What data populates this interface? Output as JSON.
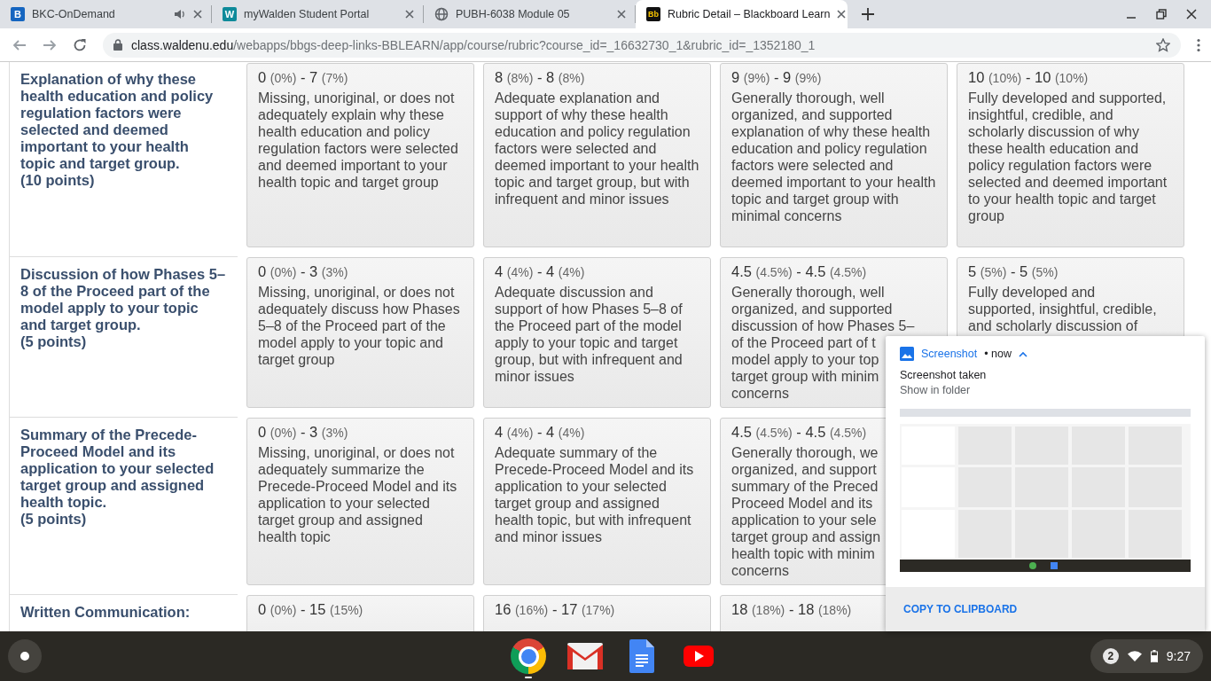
{
  "browser": {
    "tabs": [
      {
        "title": "BKC-OnDemand",
        "selected": false,
        "playing_audio": true,
        "favicon": {
          "kind": "letter",
          "glyph": "B",
          "color": "#1565c0"
        }
      },
      {
        "title": "myWalden Student Portal",
        "selected": false,
        "playing_audio": false,
        "favicon": {
          "kind": "letter",
          "glyph": "W",
          "color": "#0e8a9a"
        }
      },
      {
        "title": "PUBH-6038 Module 05",
        "selected": false,
        "playing_audio": false,
        "favicon": {
          "kind": "globe"
        }
      },
      {
        "title": "Rubric Detail – Blackboard Learn",
        "selected": true,
        "playing_audio": false,
        "favicon": {
          "kind": "letter",
          "glyph": "Bb",
          "color": "#111111"
        }
      }
    ],
    "address": {
      "host": "class.waldenu.edu",
      "path": "/webapps/bbgs-deep-links-BBLEARN/app/course/rubric?course_id=_16632730_1&rubric_id=_1352180_1"
    }
  },
  "rubric": {
    "rows": [
      {
        "criterion": "Explanation of why these health education and policy regulation factors were selected and deemed important to your health topic and target group.",
        "points": "(10 points)",
        "cells": [
          {
            "range": [
              "0 ",
              "(0%)",
              " - 7 ",
              "(7%)"
            ],
            "description": "Missing, unoriginal, or does not adequately explain why these health education and policy regulation factors were selected and deemed important to your health topic and target group"
          },
          {
            "range": [
              "8 ",
              "(8%)",
              " - 8 ",
              "(8%)"
            ],
            "description": "Adequate explanation and support of why these health education and policy regulation factors were selected and deemed important to your health topic and target group, but with infrequent and minor issues"
          },
          {
            "range": [
              "9 ",
              "(9%)",
              " - 9 ",
              "(9%)"
            ],
            "description": "Generally thorough, well organized, and supported explanation of why these health education and policy regulation factors were selected and deemed important to your health topic and target group with minimal concerns"
          },
          {
            "range": [
              "10 ",
              "(10%)",
              " - 10 ",
              "(10%)"
            ],
            "description": "Fully developed and supported, insightful, credible, and scholarly discussion of why these health education and policy regulation factors were selected and deemed important to your health topic and target group"
          }
        ]
      },
      {
        "criterion": "Discussion of how Phases 5–8 of the Proceed part of the model apply to your topic and target group.",
        "points": "(5 points)",
        "cells": [
          {
            "range": [
              "0 ",
              "(0%)",
              " - 3 ",
              "(3%)"
            ],
            "description": "Missing, unoriginal, or does not adequately discuss how Phases 5–8 of the Proceed part of the model apply to your topic and target group"
          },
          {
            "range": [
              "4 ",
              "(4%)",
              " - 4 ",
              "(4%)"
            ],
            "description": "Adequate discussion and support of how Phases 5–8 of the Proceed part of the model apply to your topic and target group, but with infrequent and minor issues"
          },
          {
            "range": [
              "4.5 ",
              "(4.5%)",
              " - 4.5 ",
              "(4.5%)"
            ],
            "description": "Generally thorough, well\norganized, and supported\ndiscussion of how Phases 5–\nof the Proceed part of t\nmodel apply to your top\ntarget group with minim\nconcerns"
          },
          {
            "range": [
              "5 ",
              "(5%)",
              " - 5 ",
              "(5%)"
            ],
            "description": "Fully developed and\nsupported, insightful, credible,\nand scholarly discussion of"
          }
        ]
      },
      {
        "criterion": "Summary of the Precede-Proceed Model and its application to your selected target group and assigned health topic.",
        "points": "(5 points)",
        "cells": [
          {
            "range": [
              "0 ",
              "(0%)",
              " - 3 ",
              "(3%)"
            ],
            "description": "Missing, unoriginal, or does not adequately summarize the Precede-Proceed Model and its application to your selected target group and assigned health topic"
          },
          {
            "range": [
              "4 ",
              "(4%)",
              " - 4 ",
              "(4%)"
            ],
            "description": "Adequate summary of the Precede-Proceed Model and its application to your selected target group and assigned health topic, but with infrequent and minor issues"
          },
          {
            "range": [
              "4.5 ",
              "(4.5%)",
              " - 4.5 ",
              "(4.5%)"
            ],
            "description": "Generally thorough, we\norganized, and support\nsummary of the Preced\nProceed Model and its\napplication to your sele\ntarget group and assign\nhealth topic with minim\nconcerns"
          },
          {}
        ]
      },
      {
        "criterion": "Written Communication:",
        "cells": [
          {
            "range": [
              "0 ",
              "(0%)",
              " - 15 ",
              "(15%)"
            ]
          },
          {
            "range": [
              "16 ",
              "(16%)",
              " - 17 ",
              "(17%)"
            ]
          },
          {
            "range": [
              "18 ",
              "(18%)",
              " - 18 ",
              "(18%)"
            ]
          },
          {}
        ]
      }
    ]
  },
  "notification": {
    "app": "Screenshot",
    "time": "• now",
    "expanded": true,
    "title": "Screenshot taken",
    "subtitle": "Show in folder",
    "action": "COPY TO CLIPBOARD"
  },
  "shelf": {
    "apps": [
      {
        "kind": "chrome",
        "running": true
      },
      {
        "kind": "gmail",
        "running": false
      },
      {
        "kind": "docs",
        "running": false
      },
      {
        "kind": "youtube",
        "running": false
      }
    ],
    "status": {
      "notifications": "2",
      "time": "9:27"
    }
  }
}
